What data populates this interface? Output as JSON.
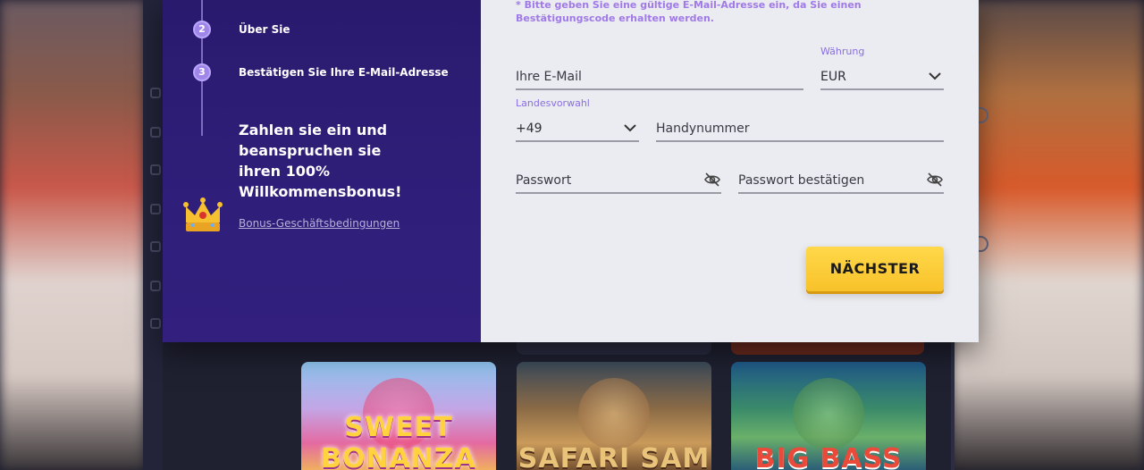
{
  "modal": {
    "steps": [
      {
        "number": "2",
        "label": "Über Sie"
      },
      {
        "number": "3",
        "label": "Bestätigen Sie Ihre E-Mail-Adresse"
      }
    ],
    "promo_text": "Zahlen sie ein und beanspruchen sie ihren 100% Willkommensbonus!",
    "terms_link": "Bonus-Geschäftsbedingungen",
    "notice": "* Bitte geben Sie eine gültige E-Mail-Adresse ein, da Sie einen Bestätigungscode erhalten werden.",
    "form": {
      "email_placeholder": "Ihre E-Mail",
      "currency_label": "Währung",
      "currency_value": "EUR",
      "country_code_label": "Landesvorwahl",
      "country_code_value": "+49",
      "phone_placeholder": "Handynummer",
      "password_placeholder": "Passwort",
      "confirm_password_placeholder": "Passwort bestätigen"
    },
    "next_button": "NÄCHSTER"
  },
  "background": {
    "games": [
      {
        "title": "SWEET BONANZA"
      },
      {
        "title": "SAFARI SAM"
      },
      {
        "title": "BIG BASS"
      }
    ]
  },
  "colors": {
    "modal_left_bg": "#2a1a6e",
    "modal_right_bg": "#ebecf1",
    "accent_purple": "#8a6ee0",
    "button_yellow": "#f8c22a"
  },
  "icons": {
    "password_toggle": "eye-off-icon",
    "dropdown": "chevron-down-icon",
    "crown": "crown-icon"
  }
}
